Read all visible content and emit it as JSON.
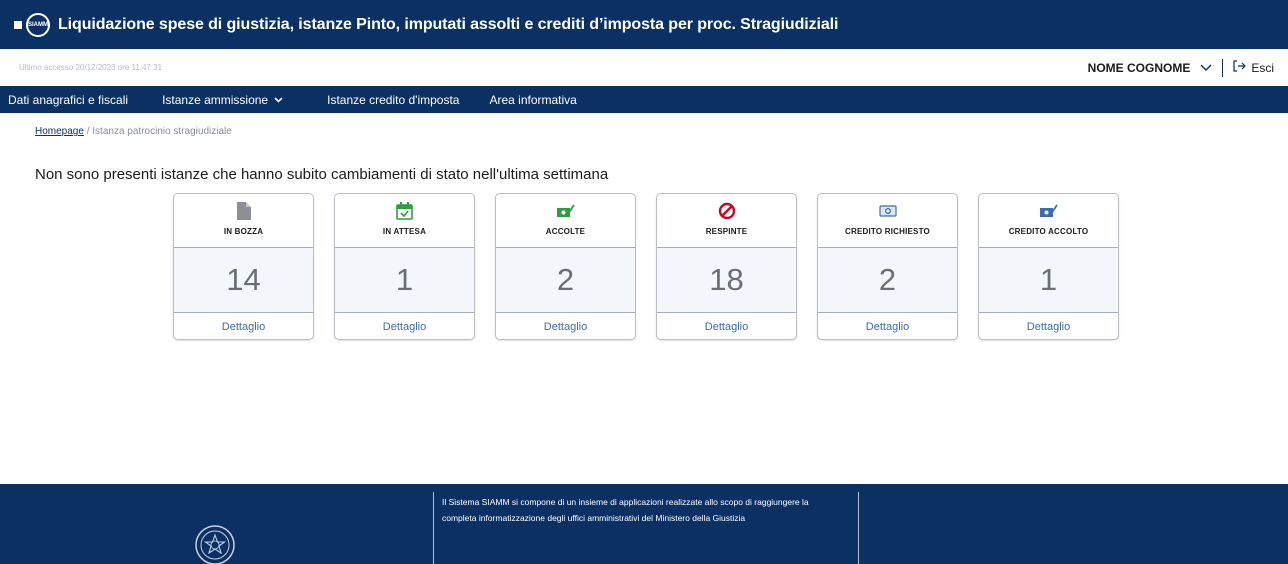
{
  "header": {
    "logo_text": "SIAMM",
    "title": "Liquidazione spese di giustizia, istanze Pinto, imputati assolti e crediti d’imposta per proc. Stragiudiziali"
  },
  "userbar": {
    "last_access": "Ultimo accesso 20/12/2023 ore 11:47:31",
    "user_name": "NOME COGNOME",
    "logout_label": "Esci"
  },
  "nav": {
    "items": [
      {
        "label": "Dati anagrafici e fiscali"
      },
      {
        "label": "Istanze ammissione"
      },
      {
        "label": "Istanze credito d'imposta"
      },
      {
        "label": "Area informativa"
      }
    ]
  },
  "breadcrumb": {
    "home": "Homepage",
    "separator": " / ",
    "current": "Istanza patrocinio stragiudiziale"
  },
  "notice": "Non sono presenti istanze che hanno subito cambiamenti di stato nell'ultima settimana",
  "cards": [
    {
      "label": "IN BOZZA",
      "count": "14",
      "link": "Dettaglio",
      "icon": "document-icon"
    },
    {
      "label": "IN ATTESA",
      "count": "1",
      "link": "Dettaglio",
      "icon": "calendar-check-icon"
    },
    {
      "label": "ACCOLTE",
      "count": "2",
      "link": "Dettaglio",
      "icon": "money-check-icon"
    },
    {
      "label": "RESPINTE",
      "count": "18",
      "link": "Dettaglio",
      "icon": "ban-icon"
    },
    {
      "label": "CREDITO RICHIESTO",
      "count": "2",
      "link": "Dettaglio",
      "icon": "banknote-icon"
    },
    {
      "label": "CREDITO ACCOLTO",
      "count": "1",
      "link": "Dettaglio",
      "icon": "money-check-blue-icon"
    }
  ],
  "footer": {
    "text": "Il Sistema SIAMM si compone di un insieme di applicazioni realizzate allo scopo di raggiungere la completa informatizzazione degli uffici amministrativi del Ministero della Giustizia"
  },
  "colors": {
    "brand": "#0b3063",
    "link": "#3c6cb3",
    "green": "#2e9e3c",
    "red": "#d1001c",
    "grey_icon": "#8c9096"
  }
}
